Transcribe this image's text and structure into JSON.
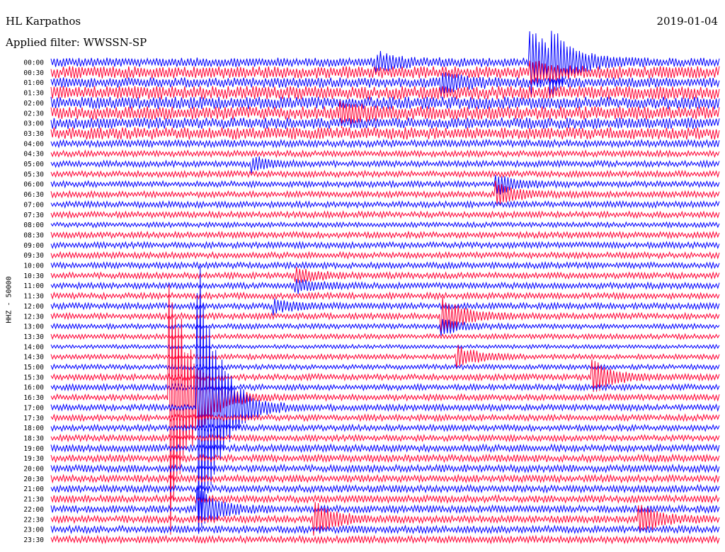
{
  "header": {
    "station": "HL Karpathos",
    "date": "2019-01-04",
    "filter": "Applied filter: WWSSN-SP"
  },
  "chart_data": {
    "type": "line",
    "title": "HL Karpathos",
    "ylabel": "HHZ - 50000",
    "rows": [
      "00:00",
      "00:30",
      "01:00",
      "01:30",
      "02:00",
      "02:30",
      "03:00",
      "03:30",
      "04:00",
      "04:30",
      "05:00",
      "05:30",
      "06:00",
      "06:30",
      "07:00",
      "07:30",
      "08:00",
      "08:30",
      "09:00",
      "09:30",
      "10:00",
      "10:30",
      "11:00",
      "11:30",
      "12:00",
      "12:30",
      "13:00",
      "13:30",
      "14:00",
      "14:30",
      "15:00",
      "15:30",
      "16:00",
      "16:30",
      "17:00",
      "17:30",
      "18:00",
      "18:30",
      "19:00",
      "19:30",
      "20:00",
      "20:30",
      "21:00",
      "21:30",
      "22:00",
      "22:30",
      "23:00",
      "23:30"
    ],
    "row_minutes": 30,
    "colors": [
      "#0000ff",
      "#ff0033"
    ],
    "noise_level": [
      4.5,
      6,
      5,
      6.5,
      6,
      6.5,
      5.5,
      6,
      3.5,
      3,
      3,
      3,
      3,
      3,
      3,
      3,
      2.5,
      3,
      3,
      3,
      3,
      3,
      3,
      3,
      3,
      3,
      2.5,
      2.5,
      2,
      2.5,
      2.5,
      3,
      3,
      3,
      3,
      3,
      3,
      3,
      3.5,
      3.5,
      3.5,
      3.5,
      3.5,
      3.5,
      3.5,
      3.5,
      3.5,
      3.5
    ],
    "events": [
      {
        "row": 0,
        "minute": 21.5,
        "amp": 52
      },
      {
        "row": 1,
        "minute": 21.5,
        "amp": 14
      },
      {
        "row": 0,
        "minute": 22.4,
        "amp": 40
      },
      {
        "row": 0,
        "minute": 14.6,
        "amp": 12
      },
      {
        "row": 2,
        "minute": 17.5,
        "amp": 16
      },
      {
        "row": 5,
        "minute": 13,
        "amp": 14
      },
      {
        "row": 10,
        "minute": 9,
        "amp": 10
      },
      {
        "row": 12,
        "minute": 20,
        "amp": 14
      },
      {
        "row": 13,
        "minute": 20,
        "amp": 16
      },
      {
        "row": 21,
        "minute": 11,
        "amp": 10
      },
      {
        "row": 22,
        "minute": 11,
        "amp": 10
      },
      {
        "row": 24,
        "minute": 10,
        "amp": 10
      },
      {
        "row": 25,
        "minute": 17.5,
        "amp": 30
      },
      {
        "row": 26,
        "minute": 17.5,
        "amp": 12
      },
      {
        "row": 29,
        "minute": 18.2,
        "amp": 16
      },
      {
        "row": 31,
        "minute": 24.3,
        "amp": 24
      },
      {
        "row": 33,
        "minute": 5.3,
        "amp": 220
      },
      {
        "row": 34,
        "minute": 6.6,
        "amp": 220
      },
      {
        "row": 44,
        "minute": 6.6,
        "amp": 30
      },
      {
        "row": 45,
        "minute": 11.8,
        "amp": 24
      },
      {
        "row": 45,
        "minute": 26.4,
        "amp": 22
      }
    ]
  }
}
